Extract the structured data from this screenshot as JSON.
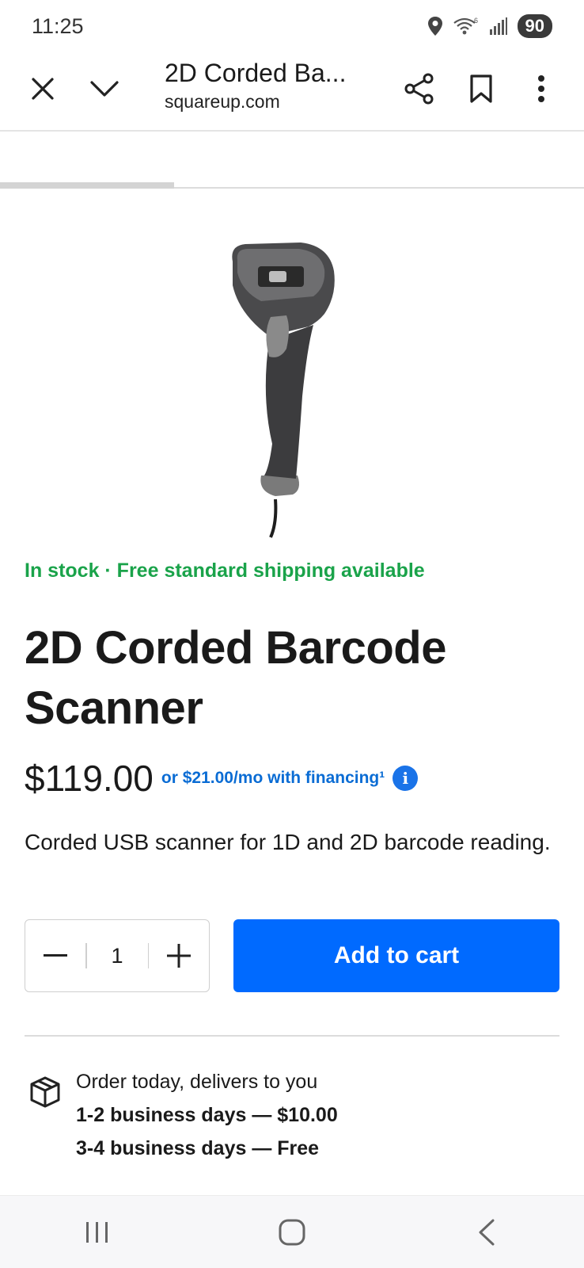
{
  "status_bar": {
    "time": "11:25",
    "wifi_label": "6",
    "battery": "90"
  },
  "browser": {
    "title": "2D Corded Ba...",
    "url": "squareup.com"
  },
  "product": {
    "stock_line": "In stock · Free standard shipping available",
    "title": "2D Corded Barcode Scanner",
    "price": "$119.00",
    "financing": "or $21.00/mo with financing¹",
    "info_glyph": "i",
    "description": "Corded USB scanner for 1D and 2D barcode reading."
  },
  "purchase": {
    "quantity": "1",
    "add_to_cart": "Add to cart"
  },
  "delivery": {
    "lead": "Order today, delivers to you",
    "options": [
      "1-2 business days — $10.00",
      "3-4 business days — Free"
    ]
  },
  "colors": {
    "accent": "#006aff",
    "stock_green": "#1aa34a",
    "link_blue": "#0a6cd4"
  },
  "icons": [
    "close-icon",
    "chevron-down-icon",
    "share-icon",
    "bookmark-icon",
    "more-vert-icon",
    "package-icon",
    "minus-icon",
    "plus-icon",
    "info-icon",
    "location-icon",
    "wifi-icon",
    "signal-icon",
    "recents-icon",
    "home-icon",
    "back-icon"
  ]
}
